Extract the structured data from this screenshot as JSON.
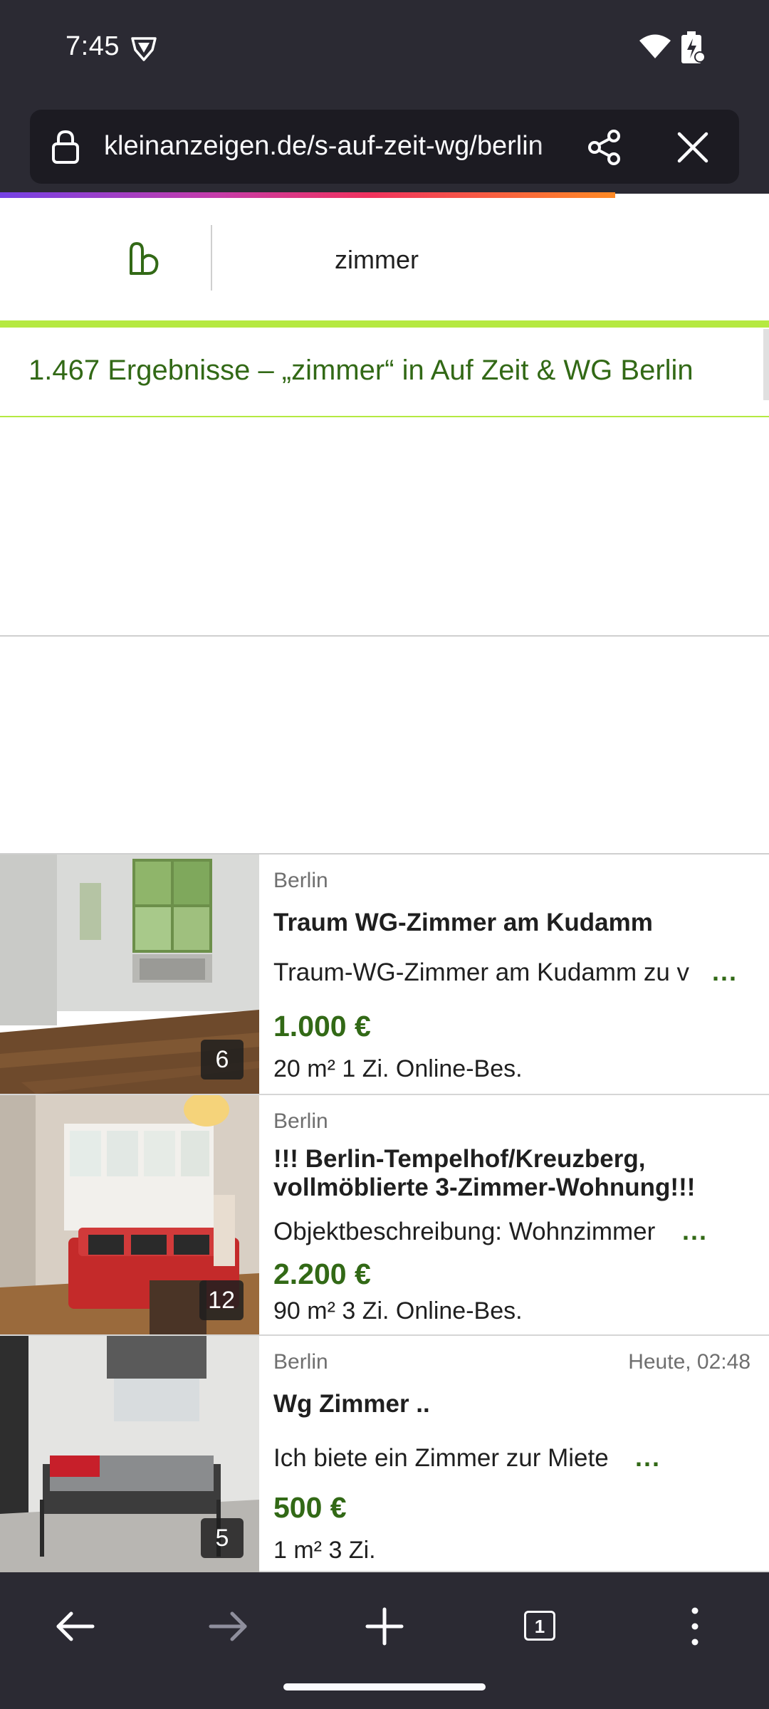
{
  "status_bar": {
    "time": "7:45"
  },
  "browser": {
    "url": "kleinanzeigen.de/s-auf-zeit-wg/berlin",
    "open_tabs": "1"
  },
  "site": {
    "search_query": "zimmer",
    "results_summary": "1.467 Ergebnisse – „zimmer“ in Auf Zeit & WG Berlin"
  },
  "listings": [
    {
      "location": "Berlin",
      "date": "",
      "title": "Traum WG-Zimmer am Kudamm",
      "description": "Traum-WG-Zimmer am Kudamm zu v",
      "more": "...",
      "price": "1.000 €",
      "tags": "20 m² 1 Zi. Online-Bes.",
      "image_count": "6"
    },
    {
      "location": "Berlin",
      "date": "",
      "title": "!!! Berlin-Tempelhof/Kreuzberg, vollmöblierte 3-Zimmer-Wohnung!!!",
      "description": "Objektbeschreibung: Wohnzimmer",
      "more": "...",
      "price": "2.200 €",
      "tags": "90 m² 3 Zi. Online-Bes.",
      "image_count": "12"
    },
    {
      "location": "Berlin",
      "date": "Heute, 02:48",
      "title": "Wg Zimmer ..",
      "description": "Ich biete ein Zimmer zur Miete",
      "more": "...",
      "price": "500 €",
      "tags": "1 m² 3 Zi.",
      "image_count": "5"
    }
  ],
  "colors": {
    "brand_green": "#326916",
    "accent_lime": "#b5e941",
    "browser_chrome": "#2b2a33"
  },
  "icons": {
    "status": [
      "vpn-shield-icon",
      "wifi-icon",
      "battery-icon"
    ],
    "url_bar": [
      "lock-icon",
      "share-icon",
      "close-icon"
    ],
    "toolbar": [
      "back-arrow-icon",
      "forward-arrow-icon",
      "plus-icon",
      "tabs-icon",
      "more-vertical-icon"
    ]
  }
}
